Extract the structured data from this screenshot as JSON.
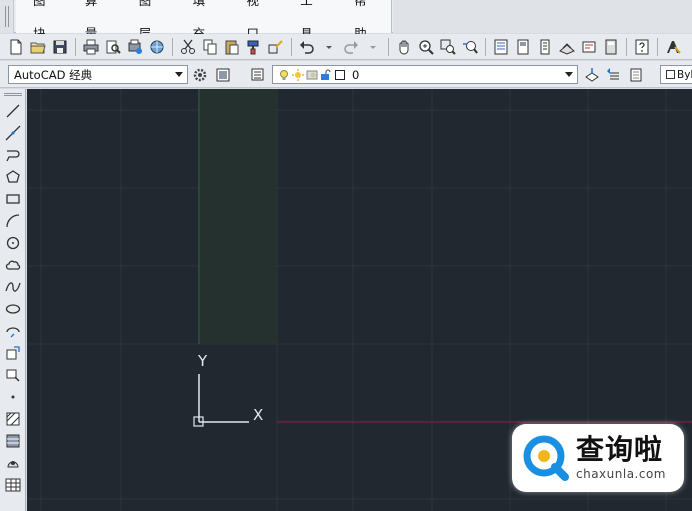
{
  "menu": {
    "items": [
      "图块",
      "算量",
      "图层",
      "填充",
      "视口",
      "工具",
      "帮助"
    ]
  },
  "toolbar_workspace": {
    "workspace_value": "AutoCAD 经典"
  },
  "toolbar_layer": {
    "layer_value": "0"
  },
  "toolbar_color": {
    "value": "ByL"
  },
  "canvas": {
    "background": "#212830",
    "ucs_y_label": "Y",
    "ucs_x_label": "X"
  },
  "watermark": {
    "logo_text": "查询啦",
    "url_text": "chaxunla.com"
  },
  "colors": {
    "grid_line": "#2d3540",
    "y_axis": "#2e5a3a",
    "x_axis": "#6e2a3a",
    "watermark_blue": "#1a8ee0"
  }
}
